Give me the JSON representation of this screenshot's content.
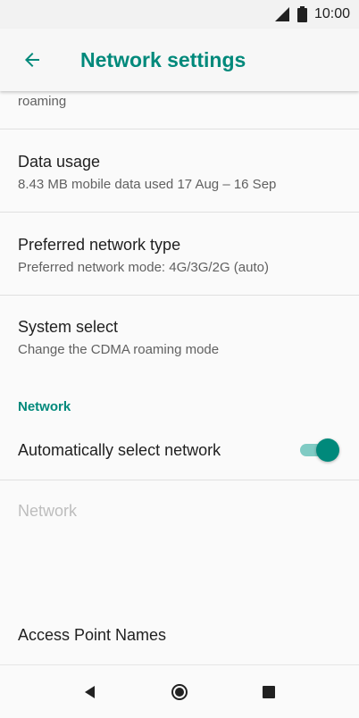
{
  "status_bar": {
    "time": "10:00"
  },
  "app_bar": {
    "title": "Network settings"
  },
  "list": {
    "roaming_summary": "roaming",
    "data_usage": {
      "title": "Data usage",
      "summary": "8.43 MB mobile data used 17 Aug – 16 Sep"
    },
    "preferred_network_type": {
      "title": "Preferred network type",
      "summary": "Preferred network mode: 4G/3G/2G (auto)"
    },
    "system_select": {
      "title": "System select",
      "summary": "Change the CDMA roaming mode"
    },
    "network_section_header": "Network",
    "auto_select_network": {
      "title": "Automatically select network",
      "enabled": true
    },
    "network_disabled_label": "Network",
    "access_point_names": "Access Point Names"
  },
  "colors": {
    "accent": "#00897b",
    "toggle_track": "#80cbc4",
    "disabled_text": "#bdbdbd"
  },
  "icons": {
    "back": "arrow-left-icon",
    "signal": "cell-signal-icon",
    "battery": "battery-icon",
    "nav_back": "triangle-back-icon",
    "nav_home": "circle-home-icon",
    "nav_recents": "square-recents-icon"
  }
}
